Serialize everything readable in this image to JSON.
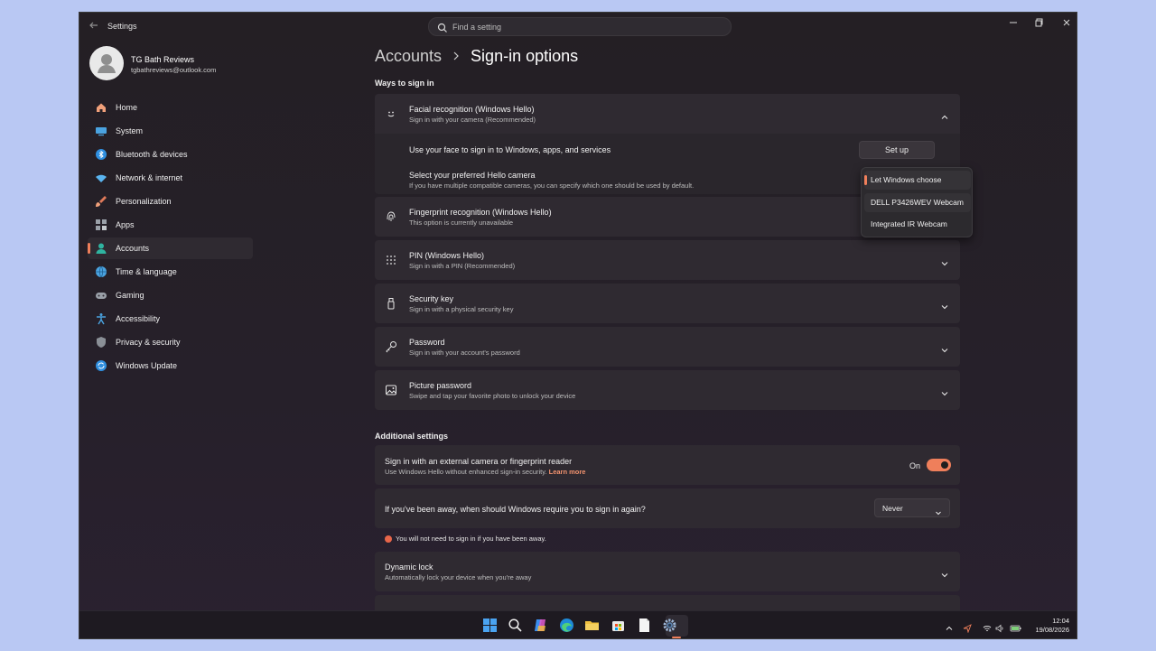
{
  "window": {
    "title": "Settings",
    "controls": [
      "minimize",
      "maximize",
      "close"
    ]
  },
  "search": {
    "placeholder": "Find a setting"
  },
  "profile": {
    "name": "TG Bath Reviews",
    "email": "tgbathreviews@outlook.com"
  },
  "sidebar": {
    "items": [
      {
        "label": "Home",
        "icon": "home-icon",
        "color": "#f0a07a"
      },
      {
        "label": "System",
        "icon": "system-icon",
        "color": "#4aa3e0"
      },
      {
        "label": "Bluetooth & devices",
        "icon": "bluetooth-icon",
        "color": "#2f8fe0"
      },
      {
        "label": "Network & internet",
        "icon": "wifi-icon",
        "color": "#5ab4f0"
      },
      {
        "label": "Personalization",
        "icon": "brush-icon",
        "color": "#e07a5a"
      },
      {
        "label": "Apps",
        "icon": "apps-icon",
        "color": "#9aa0a8"
      },
      {
        "label": "Accounts",
        "icon": "accounts-icon",
        "color": "#2fb4a0",
        "active": true
      },
      {
        "label": "Time & language",
        "icon": "globe-icon",
        "color": "#4aa3e0"
      },
      {
        "label": "Gaming",
        "icon": "gamepad-icon",
        "color": "#9aa0a8"
      },
      {
        "label": "Accessibility",
        "icon": "accessibility-icon",
        "color": "#4aa3e0"
      },
      {
        "label": "Privacy & security",
        "icon": "shield-icon",
        "color": "#8a8f96"
      },
      {
        "label": "Windows Update",
        "icon": "update-icon",
        "color": "#2f8fe0"
      }
    ]
  },
  "breadcrumb": {
    "parent": "Accounts",
    "current": "Sign-in options"
  },
  "ways_to_sign_in": {
    "title": "Ways to sign in",
    "facial": {
      "title": "Facial recognition (Windows Hello)",
      "subtitle": "Sign in with your camera (Recommended)",
      "use_face_text": "Use your face to sign in to Windows, apps, and services",
      "setup_button": "Set up",
      "camera_title": "Select your preferred Hello camera",
      "camera_subtitle": "If you have multiple compatible cameras, you can specify which one should be used by default."
    },
    "camera_options": [
      "Let Windows choose",
      "DELL P3426WEV Webcam",
      "Integrated IR Webcam"
    ],
    "camera_selected": "Let Windows choose",
    "fingerprint": {
      "title": "Fingerprint recognition (Windows Hello)",
      "subtitle": "This option is currently unavailable"
    },
    "pin": {
      "title": "PIN (Windows Hello)",
      "subtitle": "Sign in with a PIN (Recommended)"
    },
    "security_key": {
      "title": "Security key",
      "subtitle": "Sign in with a physical security key"
    },
    "password": {
      "title": "Password",
      "subtitle": "Sign in with your account's password"
    },
    "picture_password": {
      "title": "Picture password",
      "subtitle": "Swipe and tap your favorite photo to unlock your device"
    }
  },
  "additional": {
    "title": "Additional settings",
    "external_camera": {
      "title": "Sign in with an external camera or fingerprint reader",
      "subtitle": "Use Windows Hello without enhanced sign-in security.",
      "link": "Learn more",
      "state_label": "On"
    },
    "away": {
      "question": "If you've been away, when should Windows require you to sign in again?",
      "value": "Never"
    },
    "away_info": "You will not need to sign in if you have been away.",
    "dynamic_lock": {
      "title": "Dynamic lock",
      "subtitle": "Automatically lock your device when you're away"
    }
  },
  "taskbar": {
    "apps": [
      "start-icon",
      "search-icon",
      "copilot-icon",
      "edge-icon",
      "file-explorer-icon",
      "store-icon",
      "notepad-icon",
      "settings-icon"
    ],
    "time": "12:04",
    "date": "19/08/2026"
  },
  "colors": {
    "accent": "#ef7f5b",
    "card": "#2f2a31",
    "background": "#241f24"
  }
}
